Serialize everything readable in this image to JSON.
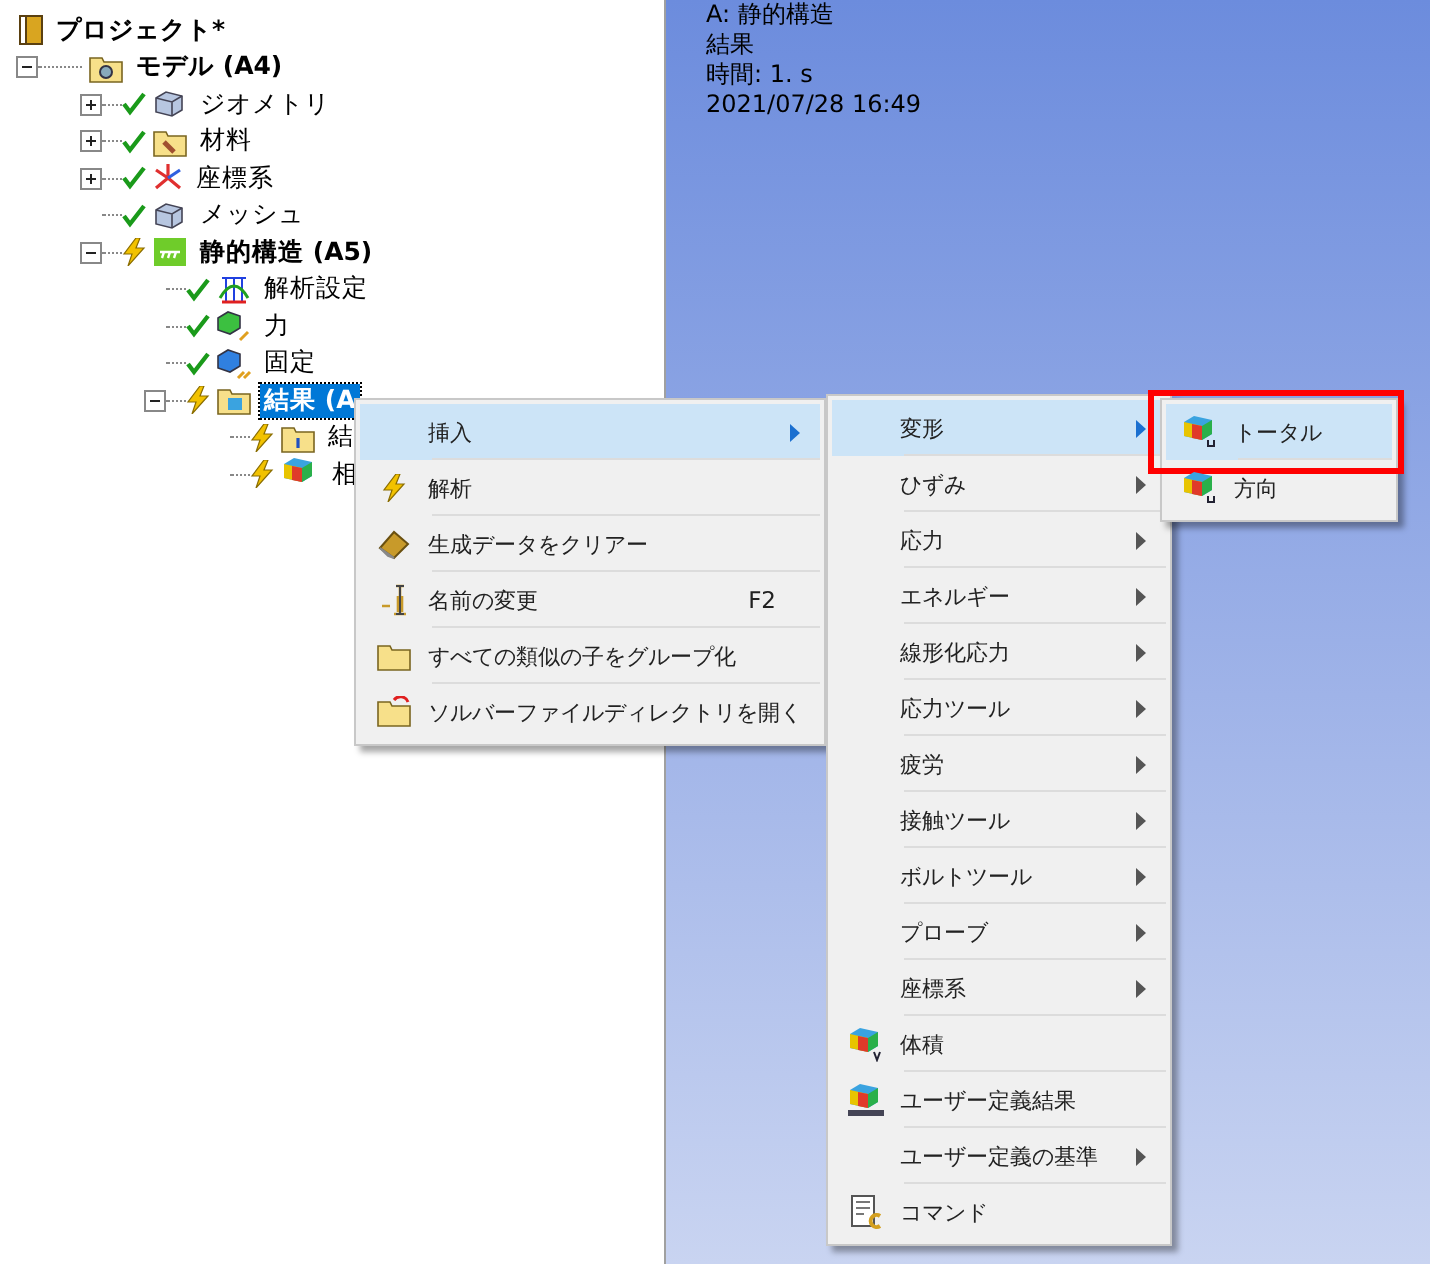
{
  "tree": {
    "label": "プロジェクト*",
    "kind": "book",
    "bold": true,
    "children": [
      {
        "label": "モデル (A4)",
        "kind": "model",
        "bold": true,
        "expanded": true,
        "selected": false,
        "children": [
          {
            "label": "ジオメトリ",
            "kind": "cubes",
            "solved": true,
            "expanded": false,
            "selected": false
          },
          {
            "label": "材料",
            "kind": "material",
            "solved": true,
            "expanded": false,
            "selected": false
          },
          {
            "label": "座標系",
            "kind": "axes",
            "solved": true,
            "expanded": false,
            "selected": false
          },
          {
            "label": "メッシュ",
            "kind": "cubes",
            "solved": true,
            "selected": false
          },
          {
            "label": "静的構造 (A5)",
            "kind": "static",
            "bold": true,
            "solved": false,
            "expanded": true,
            "selected": false,
            "children": [
              {
                "label": "解析設定",
                "kind": "settings",
                "solved": true,
                "selected": false
              },
              {
                "label": "力",
                "kind": "force",
                "solved": true,
                "selected": false
              },
              {
                "label": "固定",
                "kind": "fixed",
                "solved": true,
                "selected": false
              },
              {
                "label": "結果 (A",
                "kind": "results",
                "bold": true,
                "solved": false,
                "expanded": true,
                "selected": true,
                "children": [
                  {
                    "label": "結",
                    "kind": "info",
                    "solved": false,
                    "selected": false
                  },
                  {
                    "label": "相",
                    "kind": "contour",
                    "solved": false,
                    "selected": false
                  }
                ]
              }
            ]
          }
        ]
      }
    ]
  },
  "viewport": {
    "lines": [
      "A: 静的構造",
      "結果",
      "時間: 1. s",
      "2021/07/28 16:49"
    ]
  },
  "menus": [
    {
      "items": [
        {
          "label": "挿入",
          "submenu": true,
          "selected": true
        },
        {
          "label": "解析",
          "kind": "bolt",
          "selected": false
        },
        {
          "label": "生成データをクリアー",
          "kind": "eraser",
          "selected": false
        },
        {
          "label": "名前の変更",
          "kind": "rename",
          "shortcut": "F2",
          "selected": false
        },
        {
          "label": "すべての類似の子をグループ化",
          "kind": "folder",
          "selected": false
        },
        {
          "label": "ソルバーファイルディレクトリを開く",
          "kind": "folder-open",
          "selected": false
        }
      ]
    },
    {
      "items": [
        {
          "label": "変形",
          "submenu": true,
          "selected": true
        },
        {
          "label": "ひずみ",
          "submenu": true,
          "selected": false
        },
        {
          "label": "応力",
          "submenu": true,
          "selected": false
        },
        {
          "label": "エネルギー",
          "submenu": true,
          "selected": false
        },
        {
          "label": "線形化応力",
          "submenu": true,
          "selected": false
        },
        {
          "label": "応力ツール",
          "submenu": true,
          "selected": false
        },
        {
          "label": "疲労",
          "submenu": true,
          "selected": false
        },
        {
          "label": "接触ツール",
          "submenu": true,
          "selected": false
        },
        {
          "label": "ボルトツール",
          "submenu": true,
          "selected": false
        },
        {
          "label": "プローブ",
          "submenu": true,
          "selected": false
        },
        {
          "label": "座標系",
          "submenu": true,
          "selected": false
        },
        {
          "label": "体積",
          "kind": "contour-v",
          "selected": false
        },
        {
          "label": "ユーザー定義結果",
          "kind": "contour-user",
          "selected": false
        },
        {
          "label": "ユーザー定義の基準",
          "submenu": true,
          "selected": false
        },
        {
          "label": "コマンド",
          "kind": "command",
          "selected": false
        }
      ]
    },
    {
      "items": [
        {
          "label": "トータル",
          "kind": "contour-u",
          "selected": true,
          "annotated": true
        },
        {
          "label": "方向",
          "kind": "contour-u",
          "selected": false,
          "annotated": false
        }
      ]
    }
  ]
}
